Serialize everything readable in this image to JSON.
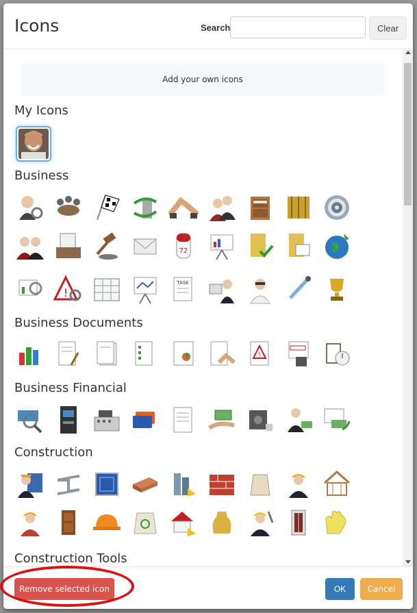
{
  "dialog": {
    "title": "Icons",
    "search_label": "Search",
    "search_value": "",
    "search_placeholder": "",
    "clear_label": "Clear",
    "upload_text": "Add your own icons"
  },
  "sections": [
    {
      "title": "My Icons"
    },
    {
      "title": "Business"
    },
    {
      "title": "Business Documents"
    },
    {
      "title": "Business Financial"
    },
    {
      "title": "Construction"
    },
    {
      "title": "Construction Tools"
    }
  ],
  "footer": {
    "remove_label": "Remove selected icon",
    "ok_label": "OK",
    "cancel_label": "Cancel"
  },
  "colors": {
    "primary": "#337ab7",
    "danger": "#d9534f",
    "warning": "#f0ad4e",
    "annotation": "#e01010"
  }
}
